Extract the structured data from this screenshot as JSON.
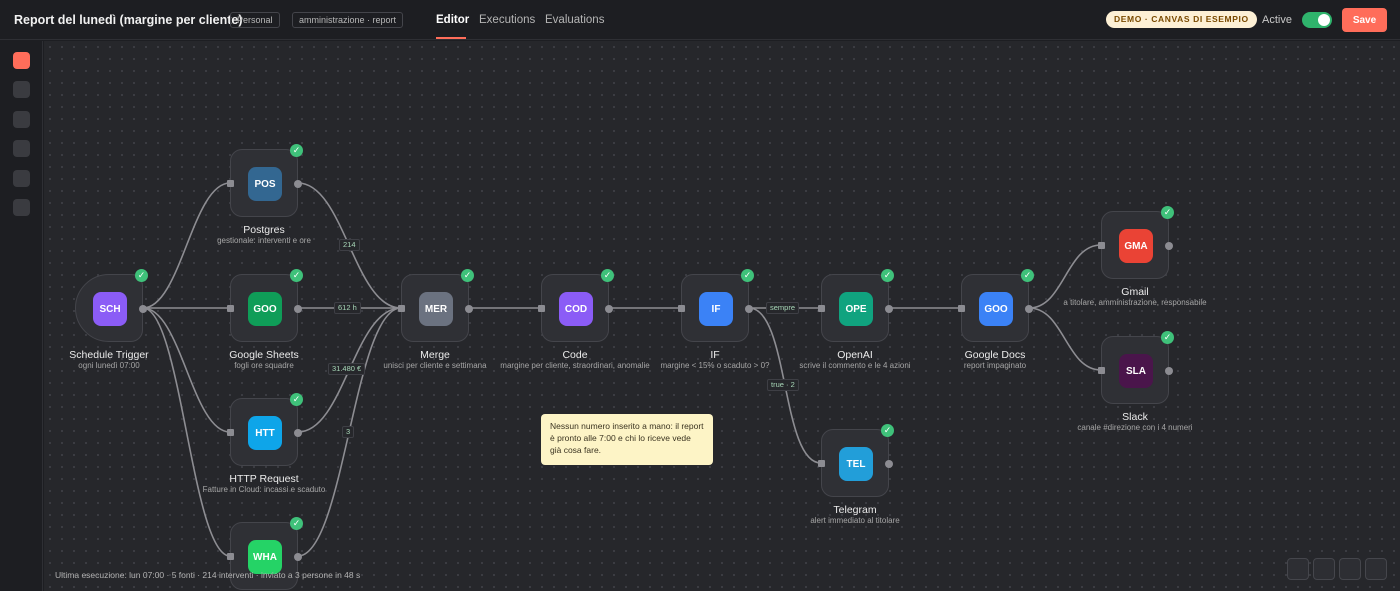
{
  "header": {
    "title": "Report del lunedì (margine per cliente)",
    "tags": [
      "Personal",
      "amministrazione · report"
    ],
    "tabs": [
      "Editor",
      "Executions",
      "Evaluations"
    ],
    "demo_badge": "DEMO · CANVAS DI ESEMPIO",
    "active_label": "Active",
    "save_label": "Save"
  },
  "colors": {
    "accent": "#ff6d5a",
    "active_toggle": "#2fb36c",
    "success_check": "#3fc17a"
  },
  "nodes": [
    {
      "key": "schedule",
      "abbr": "SCH",
      "name": "Schedule Trigger",
      "sub": "ogni lunedì 07:00",
      "color": "#8b5cf6",
      "icon": "clock-icon"
    },
    {
      "key": "postgres",
      "abbr": "POS",
      "name": "Postgres",
      "sub": "gestionale: interventi e ore",
      "color": "#336791",
      "icon": "database-icon"
    },
    {
      "key": "sheets",
      "abbr": "GOO",
      "name": "Google Sheets",
      "sub": "fogli ore squadre",
      "color": "#0f9d58",
      "icon": "sheet-icon"
    },
    {
      "key": "http",
      "abbr": "HTT",
      "name": "HTTP Request",
      "sub": "Fatture in Cloud: incassi e scaduto",
      "color": "#0ea5e9",
      "icon": "globe-icon"
    },
    {
      "key": "whatsapp",
      "abbr": "WHA",
      "name": "",
      "sub": "",
      "color": "#25d366",
      "icon": "chat-icon"
    },
    {
      "key": "merge",
      "abbr": "MER",
      "name": "Merge",
      "sub": "unisci per cliente e settimana",
      "color": "#6b7280",
      "icon": "merge-icon"
    },
    {
      "key": "code",
      "abbr": "COD",
      "name": "Code",
      "sub": "margine per cliente, straordinari, anomalie",
      "color": "#8b5cf6",
      "icon": "code-icon"
    },
    {
      "key": "if",
      "abbr": "IF",
      "name": "IF",
      "sub": "margine < 15% o scaduto > 0?",
      "color": "#3b82f6",
      "icon": "branch-icon"
    },
    {
      "key": "openai",
      "abbr": "OPE",
      "name": "OpenAI",
      "sub": "scrive il commento e le 4 azioni",
      "color": "#10a37f",
      "icon": "ai-icon"
    },
    {
      "key": "docs",
      "abbr": "GOO",
      "name": "Google Docs",
      "sub": "report impaginato",
      "color": "#3b82f6",
      "icon": "doc-icon"
    },
    {
      "key": "gmail",
      "abbr": "GMA",
      "name": "Gmail",
      "sub": "a titolare, amministrazione, responsabile",
      "color": "#ea4335",
      "icon": "mail-icon"
    },
    {
      "key": "slack",
      "abbr": "SLA",
      "name": "Slack",
      "sub": "canale #direzione con i 4 numeri",
      "color": "#4a154b",
      "icon": "slack-icon"
    },
    {
      "key": "telegram",
      "abbr": "TEL",
      "name": "Telegram",
      "sub": "alert immediato al titolare",
      "color": "#229ed9",
      "icon": "send-icon"
    }
  ],
  "edge_labels": [
    "214",
    "612 h",
    "31.480 €",
    "3",
    "sempre",
    "true · 2"
  ],
  "sticky_note": "Nessun numero inserito a mano: il report è pronto alle 7:00 e chi lo riceve vede già cosa fare.",
  "footer_status": "Ultima esecuzione: lun 07:00 · 5 fonti · 214 interventi · inviato a 3 persone in 48 s"
}
